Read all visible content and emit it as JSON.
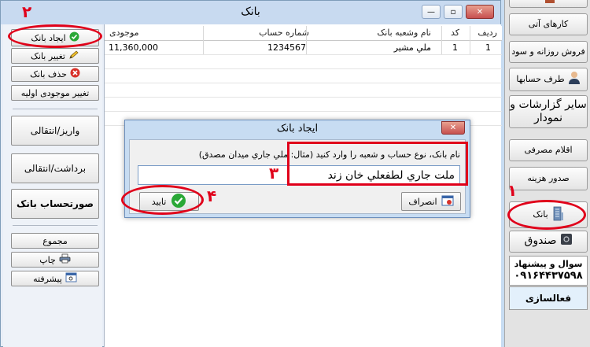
{
  "window": {
    "title": "بانک",
    "minimize": "—",
    "maximize": "▫",
    "close": "✕"
  },
  "left_panel": {
    "create_bank": "ایجاد بانک",
    "edit_bank": "تغییر بانک",
    "delete_bank": "حذف بانک",
    "change_initial_balance": "تغییر موجودی اولیه",
    "deposit_transfer": "واریز/انتقالی",
    "withdraw_transfer": "برداشت/انتقالی",
    "bank_statement": "صورتحساب بانک",
    "total": "مجموع",
    "print": "چاپ",
    "advanced": "پیشرفته"
  },
  "grid": {
    "headers": {
      "row": "ردیف",
      "code": "کد",
      "bank_name": "نام وشعبه بانک",
      "account_number": "شماره حساب",
      "balance": "موجودی"
    },
    "rows": [
      {
        "row": "1",
        "code": "1",
        "bank_name": "ملي مشير",
        "account_number": "1234567",
        "balance": "11,360,000"
      }
    ]
  },
  "dialog": {
    "title": "ایجاد بانک",
    "close": "✕",
    "prompt": "نام بانک، نوع حساب و شعبه را وارد کنید (مثال: ملي جاري ميدان مصدق)",
    "input_value": "ملت جاري لطفعلي خان زند",
    "confirm": "تایید",
    "cancel": "انصراف"
  },
  "sidebar": {
    "top_item": "",
    "future_tasks": "کارهای آتی",
    "daily_sales": "فروش روزانه و سود",
    "accounts": "طرف حسابها",
    "reports": "سایر گزارشات و نمودار",
    "consumables": "اقلام مصرفی",
    "expense": "صدور هزینه",
    "bank": "بانک",
    "cashbox": "صندوق",
    "support_label": "سوال و پیشنهاد",
    "support_phone": "۰۹۱۶۴۴۳۷۵۹۸",
    "activation": "فعالسازی"
  },
  "annotations": {
    "n1": "۱",
    "n2": "۲",
    "n3": "۳",
    "n4": "۴"
  },
  "colors": {
    "annotation": "#e0001a",
    "titlebar": "#c8daf0",
    "accent_green": "#2aa836",
    "delete_red": "#d8312a"
  }
}
